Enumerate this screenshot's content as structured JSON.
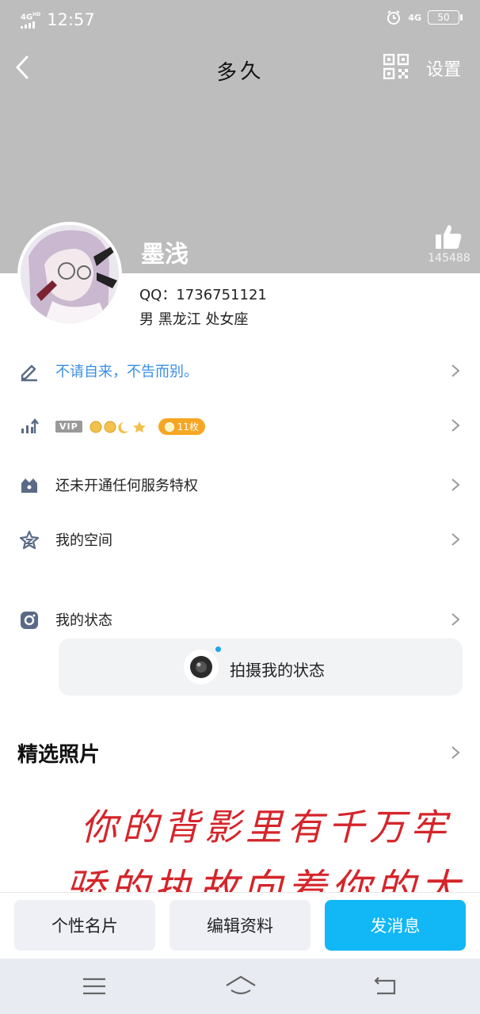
{
  "status_bar": {
    "network": "4G",
    "network_sup": "HD",
    "time": "12:57",
    "alarm_icon": "alarm-clock-icon",
    "signal_right": "4G",
    "battery": "50"
  },
  "header": {
    "signature_title": "多久",
    "settings_label": "设置",
    "qr_icon": "qr-code-icon",
    "name": "墨浅",
    "like_count": "145488"
  },
  "profile": {
    "qq": "QQ：1736751121",
    "info": "男  黑龙江  处女座"
  },
  "list": {
    "signature": "不请自来，不告而别。",
    "vip_label": "VIP",
    "medal_count": "11枚",
    "service": "还未开通任何服务特权",
    "space": "我的空间",
    "status": "我的状态",
    "shoot_status": "拍摄我的状态"
  },
  "photos": {
    "title": "精选照片",
    "line1": "你的背影里有千万牢",
    "line2": "骄的执故向着你的太阳"
  },
  "buttons": {
    "card": "个性名片",
    "edit": "编辑资料",
    "message": "发消息"
  },
  "colors": {
    "header_bg": "#bdbdbd",
    "accent": "#12b7f5",
    "signature_text": "#3a8ee6",
    "medal": "#f5a623"
  }
}
